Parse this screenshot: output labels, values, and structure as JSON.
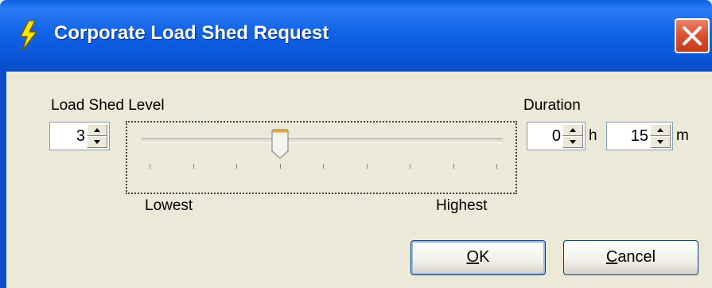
{
  "window": {
    "title": "Corporate Load Shed Request"
  },
  "load_shed": {
    "label": "Load Shed Level",
    "value": "3",
    "slider": {
      "min_label": "Lowest",
      "max_label": "Highest",
      "level": 3,
      "min": 0,
      "max": 8
    }
  },
  "duration": {
    "label": "Duration",
    "hours_value": "0",
    "hours_unit": "h",
    "minutes_value": "15",
    "minutes_unit": "m"
  },
  "buttons": {
    "ok_key": "O",
    "ok_rest": "K",
    "cancel_key": "C",
    "cancel_rest": "ancel"
  },
  "icons": {
    "title": "lightning-icon",
    "close": "close-icon",
    "spin_up": "arrow-up-icon",
    "spin_down": "arrow-down-icon",
    "thumb": "slider-thumb"
  },
  "colors": {
    "titlebar": "#0a55d8",
    "background": "#ece9d8",
    "close": "#d8502e",
    "thumb_accent": "#f5a623"
  }
}
